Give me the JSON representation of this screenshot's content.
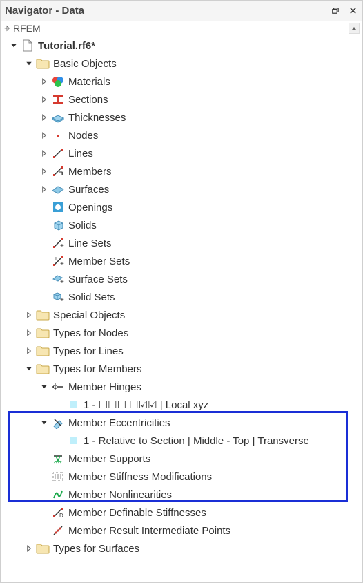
{
  "titlebar": {
    "title": "Navigator - Data"
  },
  "subheader": {
    "app": "RFEM"
  },
  "tree": {
    "root_file": "Tutorial.rf6*",
    "basic_objects": {
      "label": "Basic Objects",
      "materials": "Materials",
      "sections": "Sections",
      "thicknesses": "Thicknesses",
      "nodes": "Nodes",
      "lines": "Lines",
      "members": "Members",
      "surfaces": "Surfaces",
      "openings": "Openings",
      "solids": "Solids",
      "line_sets": "Line Sets",
      "member_sets": "Member Sets",
      "surface_sets": "Surface Sets",
      "solid_sets": "Solid Sets"
    },
    "special_objects": "Special Objects",
    "types_for_nodes": "Types for Nodes",
    "types_for_lines": "Types for Lines",
    "types_for_members": {
      "label": "Types for Members",
      "member_hinges": {
        "label": "Member Hinges",
        "item1": "1 - ☐☐☐ ☐☑☑ | Local xyz"
      },
      "member_eccentricities": {
        "label": "Member Eccentricities",
        "item1": "1 - Relative to Section | Middle - Top | Transverse"
      },
      "member_supports": "Member Supports",
      "member_stiffness_mod": "Member Stiffness Modifications",
      "member_nonlinearities": "Member Nonlinearities",
      "member_def_stiff": "Member Definable Stiffnesses",
      "member_result_pts": "Member Result Intermediate Points"
    },
    "types_for_surfaces": "Types for Surfaces"
  }
}
